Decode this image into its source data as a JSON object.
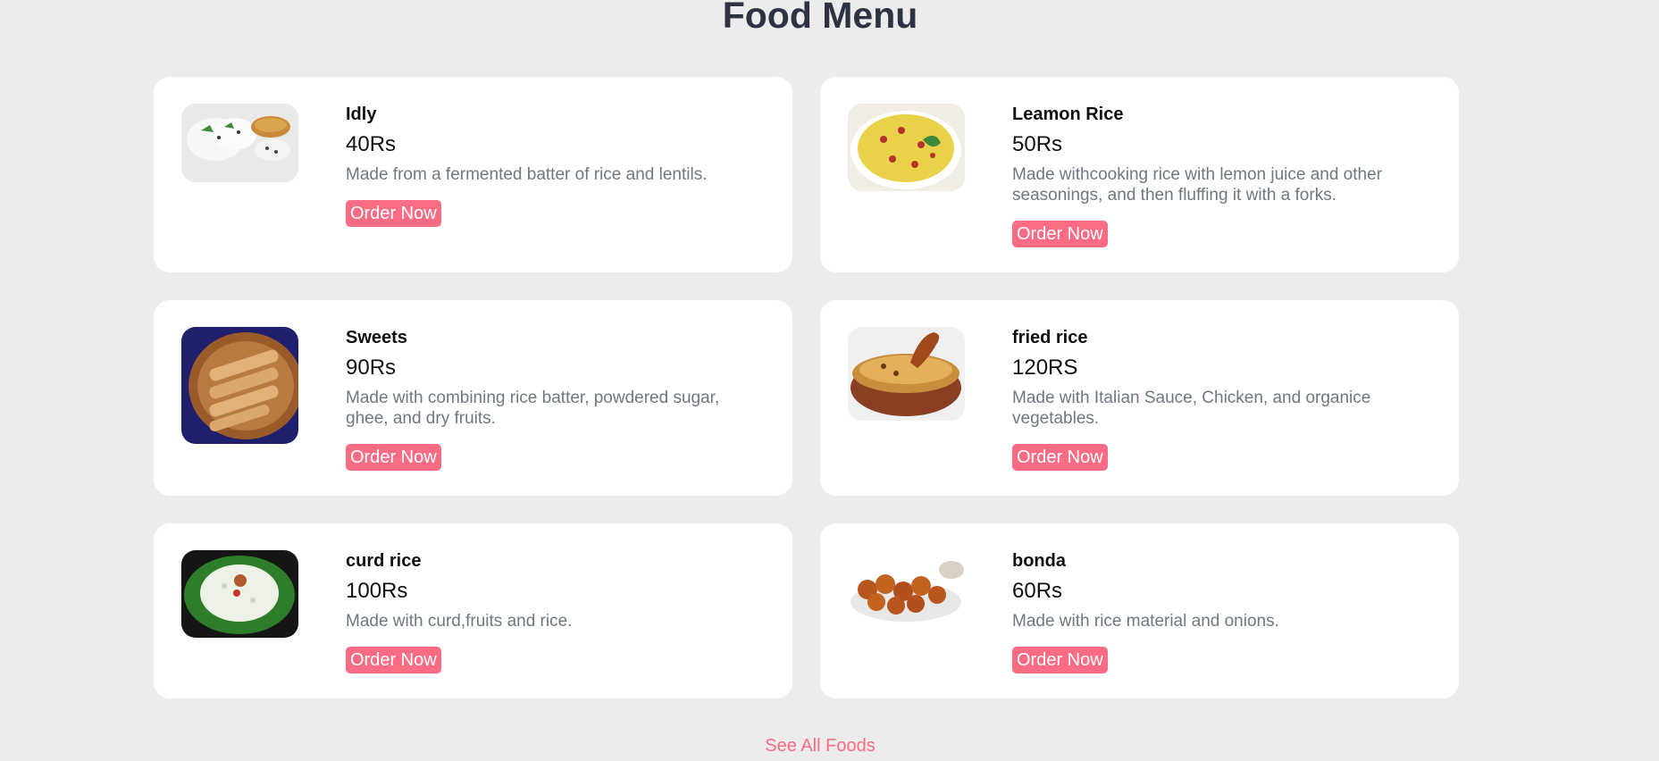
{
  "header": {
    "title": "Food Menu"
  },
  "menu": {
    "items": [
      {
        "name": "Idly",
        "price": "40Rs",
        "description": "Made from a fermented batter of rice and lentils.",
        "order_label": "Order Now",
        "image_icon": "idly-photo-icon"
      },
      {
        "name": "Leamon Rice",
        "price": "50Rs",
        "description": "Made withcooking rice with lemon juice and other seasonings, and then fluffing it with a forks.",
        "order_label": "Order Now",
        "image_icon": "lemon-rice-photo-icon"
      },
      {
        "name": "Sweets",
        "price": "90Rs",
        "description": "Made with combining rice batter, powdered sugar, ghee, and dry fruits.",
        "order_label": "Order Now",
        "image_icon": "sweets-photo-icon"
      },
      {
        "name": "fried rice",
        "price": "120RS",
        "description": "Made with Italian Sauce, Chicken, and organice vegetables.",
        "order_label": "Order Now",
        "image_icon": "fried-rice-photo-icon"
      },
      {
        "name": "curd rice",
        "price": "100Rs",
        "description": "Made with curd,fruits and rice.",
        "order_label": "Order Now",
        "image_icon": "curd-rice-photo-icon"
      },
      {
        "name": "bonda",
        "price": "60Rs",
        "description": "Made with rice material and onions.",
        "order_label": "Order Now",
        "image_icon": "bonda-photo-icon"
      }
    ]
  },
  "footer": {
    "see_all_label": "See All Foods"
  },
  "colors": {
    "background": "#ececec",
    "card": "#ffffff",
    "accent": "#fa6b84",
    "title": "#2d3342",
    "description": "#6f7780"
  }
}
